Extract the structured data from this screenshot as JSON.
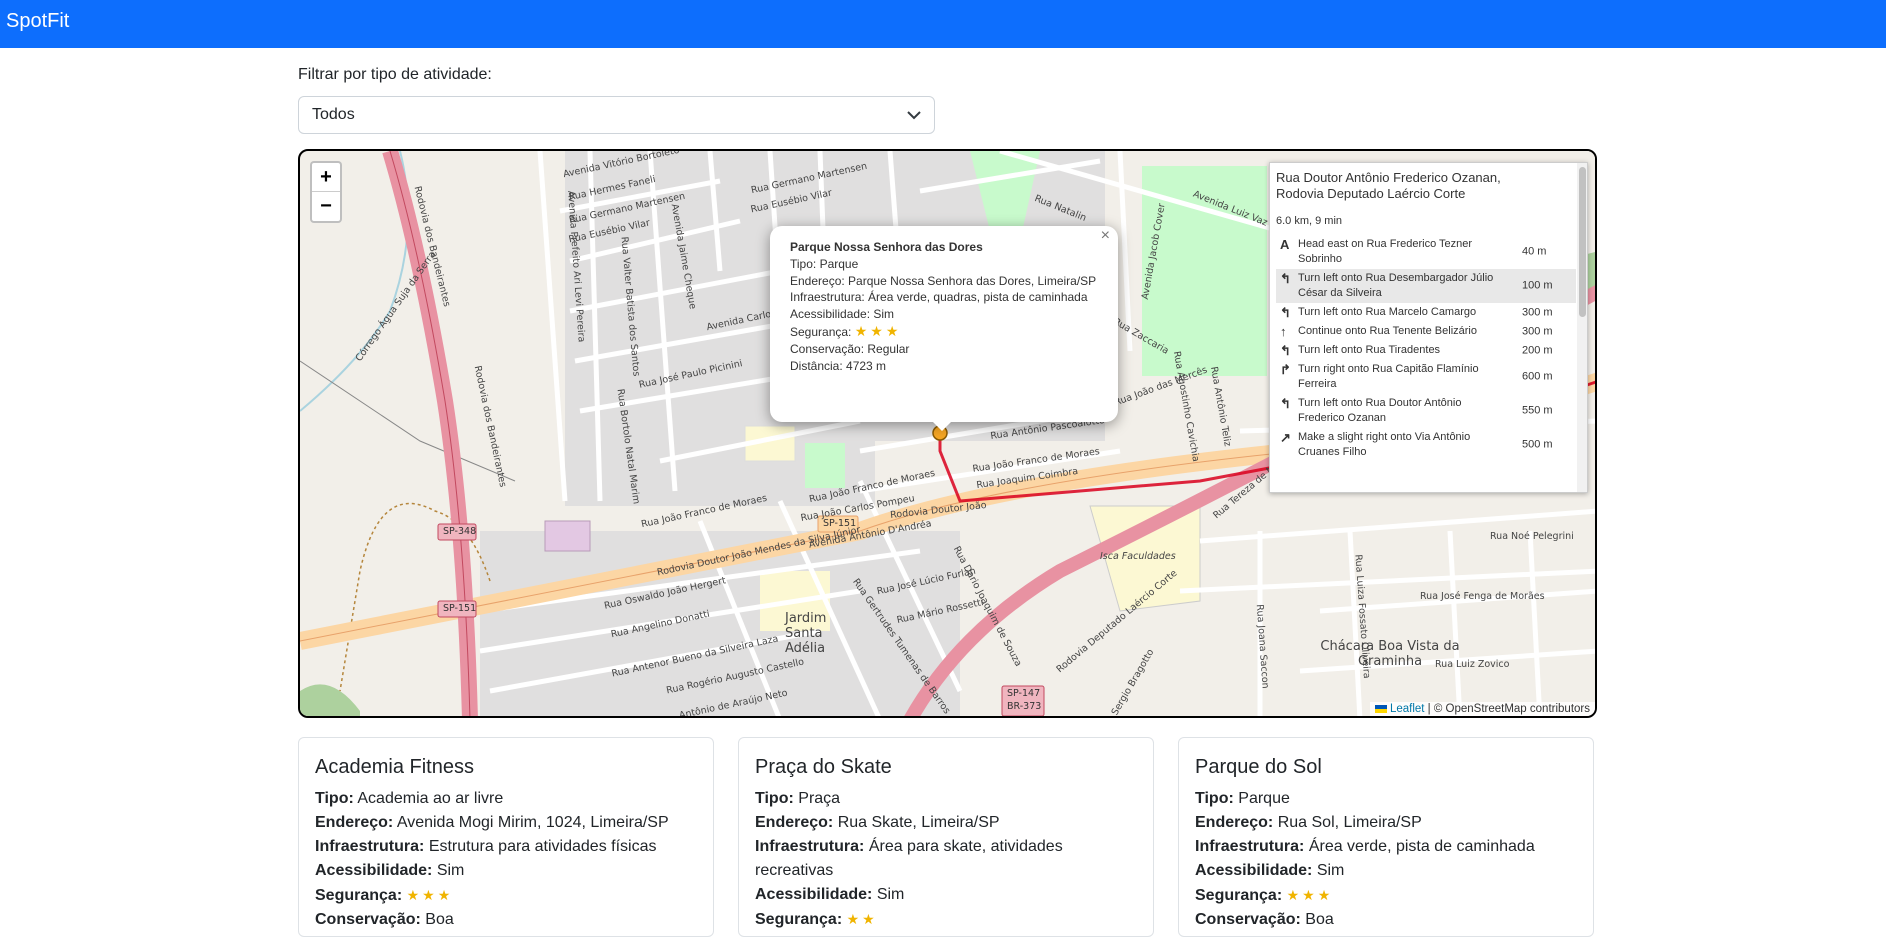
{
  "app": {
    "brand": "SpotFit"
  },
  "filter": {
    "label": "Filtrar por tipo de atividade:",
    "selected": "Todos"
  },
  "map": {
    "zoom_in": "+",
    "zoom_out": "−",
    "attribution_link": "Leaflet",
    "attribution_text": "| © OpenStreetMap contributors",
    "labels": [
      "Avenida Vitório Bortoleto",
      "Rua Hermes Faneli",
      "Rua Germano Martensen",
      "Rua Eusébio Vilar",
      "Rua Germano Martensen",
      "Rua Eusébio Vilar",
      "Rodovia dos Bandeirantes",
      "Rodovia dos Bandeirantes",
      "Córrego Água Suja da Serra",
      "Avenida Prefeito Ari Levi Pereira",
      "Avenida Jaime Cheque",
      "Rua Valter Batista dos Santos",
      "Avenida Carlos",
      "Rua José Paulo Picinini",
      "Rua Bortolo Natal Marim",
      "Rua João Franco de Moraes",
      "Rua João Franco de Moraes",
      "Rua João Franco de Moraes",
      "Rua João Carlos Pompeu",
      "Avenida Antônio D'Andréa",
      "Rua Joaquim Coimbra",
      "Rua Antônio Pascoalotto",
      "Rodovia Doutor João Mendes da Silva Júnior",
      "Rodovia Doutor João",
      "Rua Oswaldo João Hergert",
      "Rua Angelino Donatti",
      "Rua Antenor Bueno da Silveira Laza",
      "Rua Rogério Augusto Castello",
      "Antônio de Araújo Neto",
      "Jardim Santa Adélia",
      "Rua José Lúcio Furlan",
      "Rua Mário Rossetti",
      "Rua Gertrudes Tumenas de Barros",
      "Rua Dario Joaquim de Souza",
      "Isca Faculdades",
      "Rodovia Deputado Laércio Corte",
      "Rua Tereza de Munno Cruz",
      "Rua Luiza Fossato Oliveira",
      "Rua Noé Pelegrini",
      "Rua José Fenga de Morães",
      "Rua Luiz Zovico",
      "Chácara Boa Vista da Graminha",
      "Rua Joana Saccon",
      "Avenida Luiz Vaz de",
      "Rua Natalin",
      "Avenida Jacob Cover",
      "Rua Agostinho Cavichia",
      "Rua Antônio Teliz",
      "Rua João das Mercês",
      "Rua Sergio Bragotto",
      "Rua Zaccaria"
    ],
    "shields": [
      "SP-348",
      "SP-151",
      "SP-151",
      "SP-147",
      "BR-373"
    ]
  },
  "popup": {
    "close": "×",
    "name": "Parque Nossa Senhora das Dores",
    "tipo_label": "Tipo:",
    "tipo": "Parque",
    "endereco_label": "Endereço:",
    "endereco": "Parque Nossa Senhora das Dores, Limeira/SP",
    "infra_label": "Infraestrutura:",
    "infra": "Área verde, quadras, pista de caminhada",
    "acess_label": "Acessibilidade:",
    "acess": "Sim",
    "seg_label": "Segurança:",
    "seg_stars": 3,
    "cons_label": "Conservação:",
    "cons": "Regular",
    "dist_label": "Distância:",
    "dist": "4723 m"
  },
  "routing": {
    "title": "Rua Doutor Antônio Frederico Ozanan, Rodovia Deputado Laércio Corte",
    "summary": "6.0 km, 9 min",
    "steps": [
      {
        "icon": "A",
        "text": "Head east on Rua Frederico Tezner Sobrinho",
        "distance": "40 m"
      },
      {
        "icon": "↰",
        "text": "Turn left onto Rua Desembargador Júlio César da Silveira",
        "distance": "100 m"
      },
      {
        "icon": "↰",
        "text": "Turn left onto Rua Marcelo Camargo",
        "distance": "300 m"
      },
      {
        "icon": "↑",
        "text": "Continue onto Rua Tenente Belizário",
        "distance": "300 m"
      },
      {
        "icon": "↰",
        "text": "Turn left onto Rua Tiradentes",
        "distance": "200 m"
      },
      {
        "icon": "↱",
        "text": "Turn right onto Rua Capitão Flamínio Ferreira",
        "distance": "600 m"
      },
      {
        "icon": "↰",
        "text": "Turn left onto Rua Doutor Antônio Frederico Ozanan",
        "distance": "550 m"
      },
      {
        "icon": "↗",
        "text": "Make a slight right onto Via Antônio Cruanes Filho",
        "distance": "500 m"
      }
    ]
  },
  "cards": [
    {
      "title": "Academia Fitness",
      "tipo_label": "Tipo:",
      "tipo": "Academia ao ar livre",
      "endereco_label": "Endereço:",
      "endereco": "Avenida Mogi Mirim, 1024, Limeira/SP",
      "infra_label": "Infraestrutura:",
      "infra": "Estrutura para atividades físicas",
      "acess_label": "Acessibilidade:",
      "acess": "Sim",
      "seg_label": "Segurança:",
      "seg_stars": 3,
      "cons_label": "Conservação:",
      "cons": "Boa"
    },
    {
      "title": "Praça do Skate",
      "tipo_label": "Tipo:",
      "tipo": "Praça",
      "endereco_label": "Endereço:",
      "endereco": "Rua Skate, Limeira/SP",
      "infra_label": "Infraestrutura:",
      "infra": "Área para skate, atividades recreativas",
      "acess_label": "Acessibilidade:",
      "acess": "Sim",
      "seg_label": "Segurança:",
      "seg_stars": 2
    },
    {
      "title": "Parque do Sol",
      "tipo_label": "Tipo:",
      "tipo": "Parque",
      "endereco_label": "Endereço:",
      "endereco": "Rua Sol, Limeira/SP",
      "infra_label": "Infraestrutura:",
      "infra": "Área verde, pista de caminhada",
      "acess_label": "Acessibilidade:",
      "acess": "Sim",
      "seg_label": "Segurança:",
      "seg_stars": 3,
      "cons_label": "Conservação:",
      "cons": "Boa"
    }
  ]
}
